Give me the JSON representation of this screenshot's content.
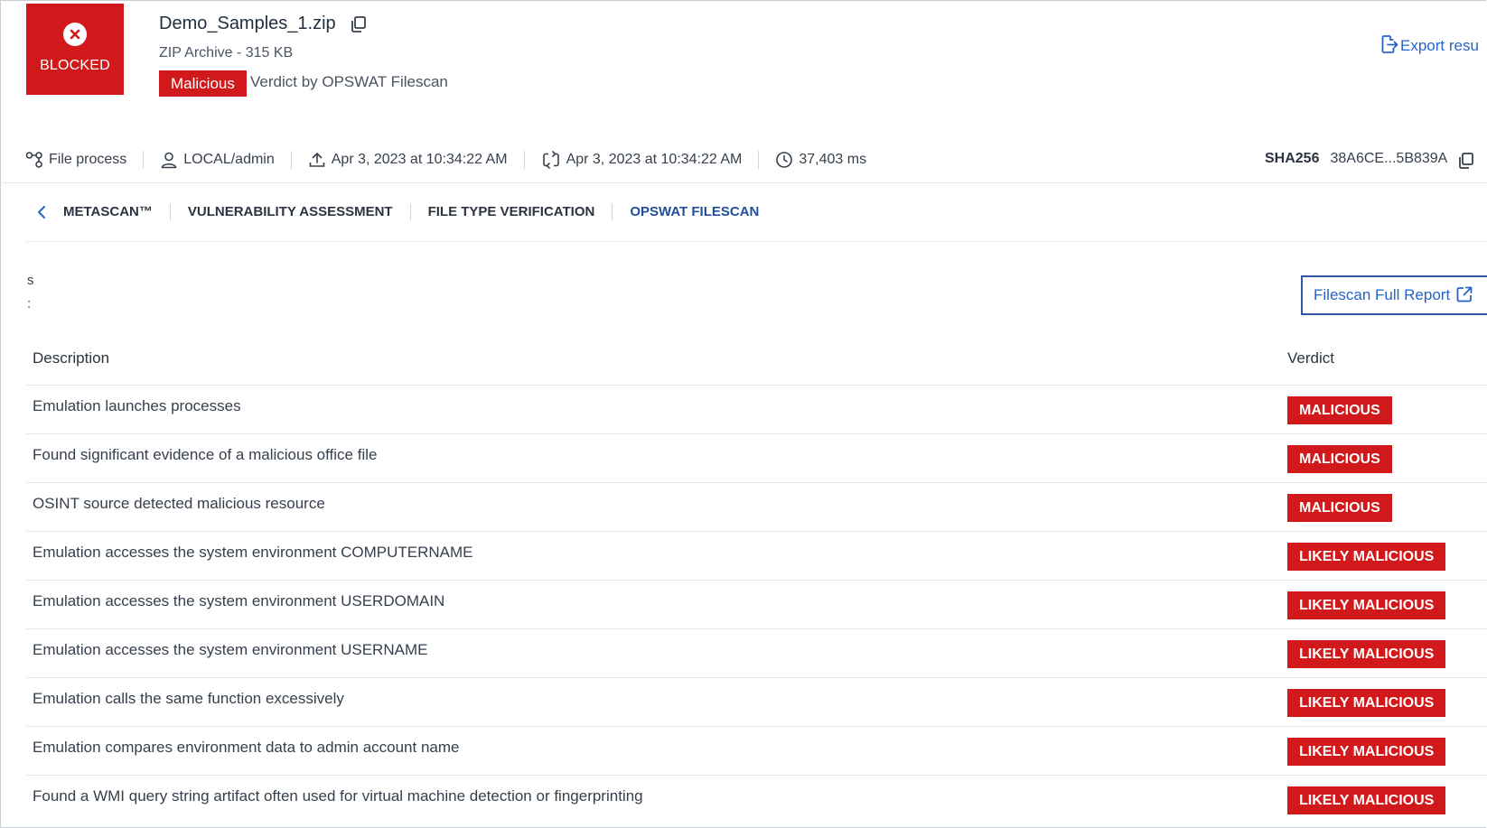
{
  "header": {
    "status_label": "BLOCKED",
    "file_name": "Demo_Samples_1.zip",
    "file_meta": "ZIP Archive - 315 KB",
    "verdict_badge": "Malicious",
    "verdict_by": "Verdict by OPSWAT Filescan",
    "export_label": "Export resu",
    "colors": {
      "danger": "#d1181a",
      "link": "#2563c9"
    }
  },
  "meta": {
    "process_label": "File process",
    "user": "LOCAL/admin",
    "uploaded": "Apr 3, 2023 at 10:34:22 AM",
    "processed": "Apr 3, 2023 at 10:34:22 AM",
    "duration": "37,403 ms",
    "sha_label": "SHA256",
    "sha_value": "38A6CE...5B839A"
  },
  "tabs": [
    {
      "label": "METASCAN™",
      "active": false
    },
    {
      "label": "VULNERABILITY ASSESSMENT",
      "active": false
    },
    {
      "label": "FILE TYPE VERIFICATION",
      "active": false
    },
    {
      "label": "OPSWAT FILESCAN",
      "active": true
    }
  ],
  "section": {
    "s_text": "s",
    "colon_text": ":",
    "report_button": "Filescan Full Report"
  },
  "table": {
    "headers": {
      "description": "Description",
      "verdict": "Verdict"
    },
    "rows": [
      {
        "description": "Emulation launches processes",
        "verdict": "MALICIOUS"
      },
      {
        "description": "Found significant evidence of a malicious office file",
        "verdict": "MALICIOUS"
      },
      {
        "description": "OSINT source detected malicious resource",
        "verdict": "MALICIOUS"
      },
      {
        "description": "Emulation accesses the system environment COMPUTERNAME",
        "verdict": "LIKELY MALICIOUS"
      },
      {
        "description": "Emulation accesses the system environment USERDOMAIN",
        "verdict": "LIKELY MALICIOUS"
      },
      {
        "description": "Emulation accesses the system environment USERNAME",
        "verdict": "LIKELY MALICIOUS"
      },
      {
        "description": "Emulation calls the same function excessively",
        "verdict": "LIKELY MALICIOUS"
      },
      {
        "description": "Emulation compares environment data to admin account name",
        "verdict": "LIKELY MALICIOUS"
      },
      {
        "description": "Found a WMI query string artifact often used for virtual machine detection or fingerprinting",
        "verdict": "LIKELY MALICIOUS"
      }
    ]
  }
}
